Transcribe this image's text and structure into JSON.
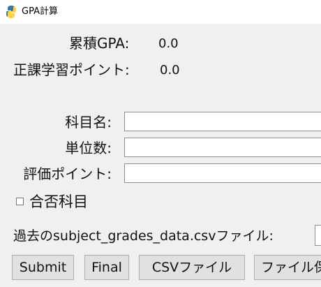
{
  "window": {
    "title": "GPA計算",
    "icon": "python-icon"
  },
  "summary": {
    "gpa_label": "累積GPA:",
    "gpa_value": "0.0",
    "points_label": "正課学習ポイント:",
    "points_value": "0.0"
  },
  "form": {
    "subject_label": "科目名:",
    "subject_value": "",
    "credits_label": "単位数:",
    "credits_value": "",
    "evaluation_label": "評価ポイント:",
    "evaluation_value": "",
    "pass_fail_label": "合否科目",
    "pass_fail_checked": false
  },
  "csv": {
    "label": "過去のsubject_grades_data.csvファイル:",
    "value": ""
  },
  "buttons": {
    "submit": "Submit",
    "final": "Final",
    "csv_file": "CSVファイル",
    "file": "ファイル保存"
  }
}
